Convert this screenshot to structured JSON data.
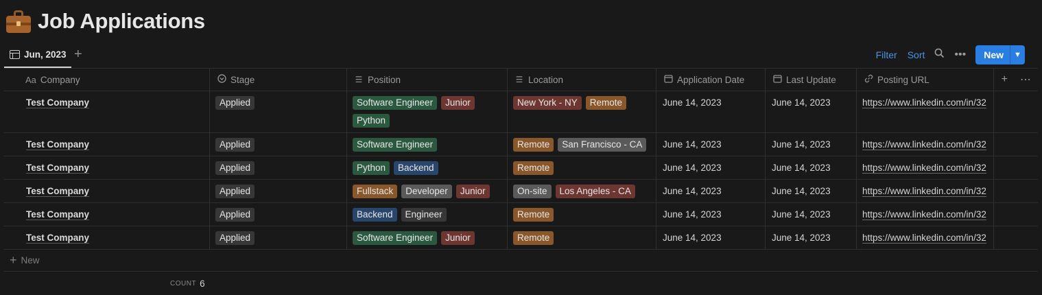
{
  "page": {
    "title": "Job Applications",
    "icon": "briefcase-icon"
  },
  "view": {
    "tab_label": "Jun, 2023",
    "add_view": "+"
  },
  "actions": {
    "filter": "Filter",
    "sort": "Sort",
    "new": "New"
  },
  "columns": [
    {
      "label": "Company",
      "icon": "Aa"
    },
    {
      "label": "Stage",
      "icon": "status-icon"
    },
    {
      "label": "Position",
      "icon": "multi-select-icon"
    },
    {
      "label": "Location",
      "icon": "multi-select-icon"
    },
    {
      "label": "Application Date",
      "icon": "calendar-icon"
    },
    {
      "label": "Last Update",
      "icon": "calendar-icon"
    },
    {
      "label": "Posting URL",
      "icon": "link-icon"
    }
  ],
  "tag_colors": {
    "green": "#2b593f",
    "red": "#6e3630",
    "orange": "#89572a",
    "gray": "#373737",
    "blue": "#28456c",
    "brown": "#603b2c",
    "lightgray": "#5a5a5a"
  },
  "rows": [
    {
      "company": "Test Company",
      "stage": "Applied",
      "position": [
        {
          "label": "Software Engineer",
          "color": "green"
        },
        {
          "label": "Junior",
          "color": "red"
        },
        {
          "label": "Python",
          "color": "green"
        }
      ],
      "location": [
        {
          "label": "New York - NY",
          "color": "red"
        },
        {
          "label": "Remote",
          "color": "orange"
        }
      ],
      "applied": "June 14, 2023",
      "updated": "June 14, 2023",
      "url": "https://www.linkedin.com/in/32"
    },
    {
      "company": "Test Company",
      "stage": "Applied",
      "position": [
        {
          "label": "Software Engineer",
          "color": "green"
        }
      ],
      "location": [
        {
          "label": "Remote",
          "color": "orange"
        },
        {
          "label": "San Francisco - CA",
          "color": "lightgray"
        }
      ],
      "applied": "June 14, 2023",
      "updated": "June 14, 2023",
      "url": "https://www.linkedin.com/in/32"
    },
    {
      "company": "Test Company",
      "stage": "Applied",
      "position": [
        {
          "label": "Python",
          "color": "green"
        },
        {
          "label": "Backend",
          "color": "blue"
        }
      ],
      "location": [
        {
          "label": "Remote",
          "color": "orange"
        }
      ],
      "applied": "June 14, 2023",
      "updated": "June 14, 2023",
      "url": "https://www.linkedin.com/in/32"
    },
    {
      "company": "Test Company",
      "stage": "Applied",
      "position": [
        {
          "label": "Fullstack",
          "color": "orange"
        },
        {
          "label": "Developer",
          "color": "lightgray"
        },
        {
          "label": "Junior",
          "color": "red"
        }
      ],
      "location": [
        {
          "label": "On-site",
          "color": "lightgray"
        },
        {
          "label": "Los Angeles - CA",
          "color": "red"
        }
      ],
      "applied": "June 14, 2023",
      "updated": "June 14, 2023",
      "url": "https://www.linkedin.com/in/32"
    },
    {
      "company": "Test Company",
      "stage": "Applied",
      "position": [
        {
          "label": "Backend",
          "color": "blue"
        },
        {
          "label": "Engineer",
          "color": "gray"
        }
      ],
      "location": [
        {
          "label": "Remote",
          "color": "orange"
        }
      ],
      "applied": "June 14, 2023",
      "updated": "June 14, 2023",
      "url": "https://www.linkedin.com/in/32"
    },
    {
      "company": "Test Company",
      "stage": "Applied",
      "position": [
        {
          "label": "Software Engineer",
          "color": "green"
        },
        {
          "label": "Junior",
          "color": "red"
        }
      ],
      "location": [
        {
          "label": "Remote",
          "color": "orange"
        }
      ],
      "applied": "June 14, 2023",
      "updated": "June 14, 2023",
      "url": "https://www.linkedin.com/in/32"
    }
  ],
  "footer": {
    "new_row": "New",
    "count_label": "COUNT",
    "count_value": "6"
  }
}
